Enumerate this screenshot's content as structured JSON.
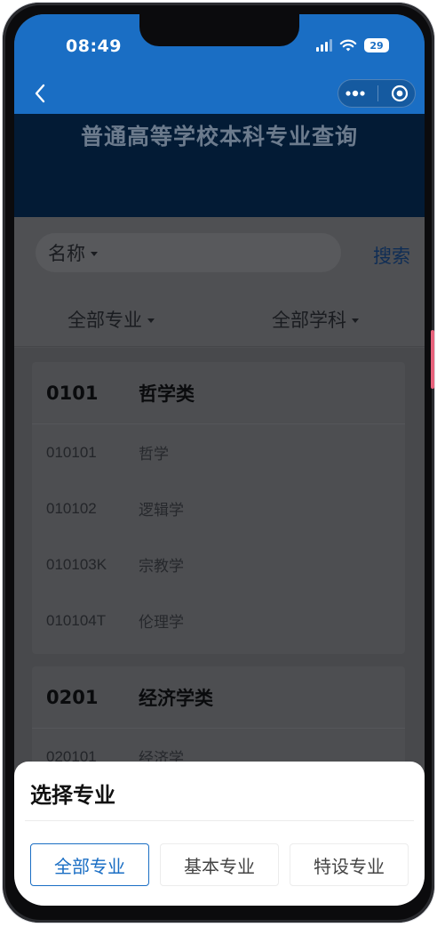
{
  "status_bar": {
    "time": "08:49",
    "battery": "29"
  },
  "banner": {
    "title": "普通高等学校本科专业查询"
  },
  "search": {
    "field_label": "名称",
    "button_label": "搜索"
  },
  "filters": {
    "major": "全部专业",
    "subject": "全部学科"
  },
  "groups": [
    {
      "code": "0101",
      "name": "哲学类",
      "items": [
        {
          "code": "010101",
          "name": "哲学"
        },
        {
          "code": "010102",
          "name": "逻辑学"
        },
        {
          "code": "010103K",
          "name": "宗教学"
        },
        {
          "code": "010104T",
          "name": "伦理学"
        }
      ]
    },
    {
      "code": "0201",
      "name": "经济学类",
      "items": [
        {
          "code": "020101",
          "name": "经济学"
        }
      ]
    }
  ],
  "sheet": {
    "title": "选择专业",
    "options": [
      "全部专业",
      "基本专业",
      "特设专业"
    ],
    "selected": "全部专业"
  },
  "colors": {
    "primary": "#1a6ec4",
    "banner": "#031b35",
    "accent": "#e8637c"
  }
}
